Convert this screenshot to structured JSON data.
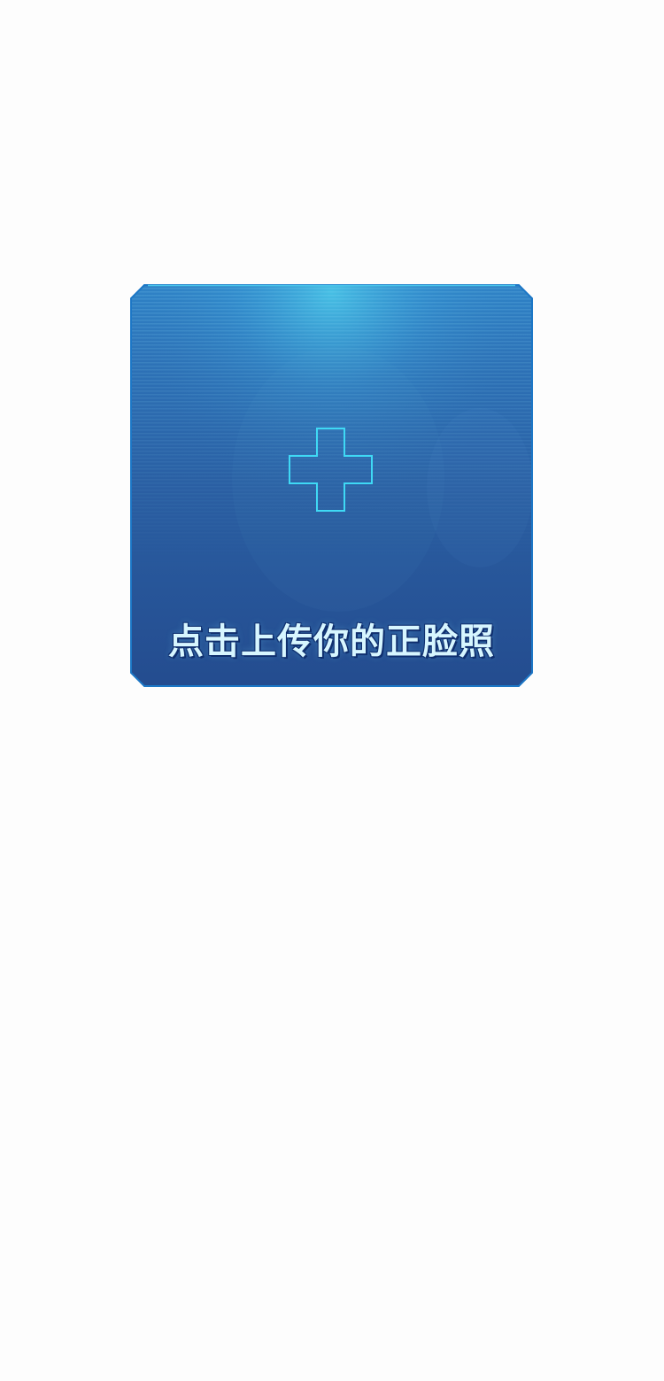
{
  "upload": {
    "label": "点击上传你的正脸照",
    "icon": "plus-icon"
  },
  "colors": {
    "page_background": "#fdfdfd",
    "card_top": "#2f8fd0",
    "card_mid": "#2a63a8",
    "card_bottom": "#244a8c",
    "frame_edge": "#1a6fc0",
    "accent": "#3fd9f5",
    "label_text": "#d7f6ff"
  }
}
